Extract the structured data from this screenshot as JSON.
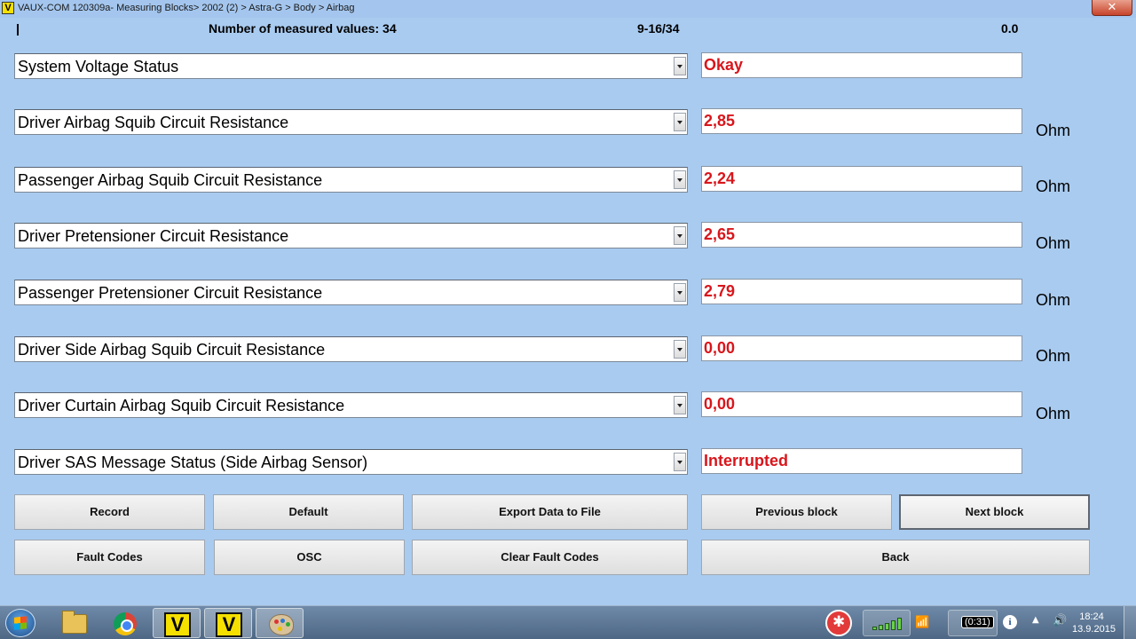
{
  "window": {
    "icon_letter": "V",
    "title": "VAUX-COM 120309a- Measuring Blocks> 2002 (2) > Astra-G > Body > Airbag",
    "close_symbol": "✕"
  },
  "header": {
    "measured_values": "Number of measured values: 34",
    "range": "9-16/34",
    "reading": "0.0"
  },
  "rows": [
    {
      "label": "System Voltage Status",
      "value": "Okay",
      "unit": ""
    },
    {
      "label": "Driver Airbag Squib Circuit Resistance",
      "value": "2,85",
      "unit": "Ohm"
    },
    {
      "label": "Passenger Airbag Squib Circuit Resistance",
      "value": "2,24",
      "unit": "Ohm"
    },
    {
      "label": "Driver Pretensioner Circuit Resistance",
      "value": "2,65",
      "unit": "Ohm"
    },
    {
      "label": "Passenger Pretensioner Circuit Resistance",
      "value": "2,79",
      "unit": "Ohm"
    },
    {
      "label": "Driver Side Airbag Squib Circuit Resistance",
      "value": "0,00",
      "unit": "Ohm"
    },
    {
      "label": "Driver Curtain Airbag Squib Circuit Resistance",
      "value": "0,00",
      "unit": "Ohm"
    },
    {
      "label": "Driver SAS Message Status (Side Airbag Sensor)",
      "value": "Interrupted",
      "unit": ""
    }
  ],
  "buttons": {
    "record": "Record",
    "default": "Default",
    "export": "Export Data to File",
    "previous_block": "Previous block",
    "next_block": "Next block",
    "fault_codes": "Fault Codes",
    "osc": "OSC",
    "clear_fault_codes": "Clear Fault Codes",
    "back": "Back"
  },
  "taskbar": {
    "vaux_icon_letter": "V",
    "battery_time": "(0:31)",
    "info_symbol": "i",
    "tray_arrow": "▲",
    "speaker_symbol": "🔊",
    "wifi_symbol": "📶",
    "time": "18:24",
    "date": "13.9.2015"
  },
  "colors": {
    "background": "#a9cbf0",
    "value_text": "#d8161c",
    "taskbar": "#4d6785"
  }
}
